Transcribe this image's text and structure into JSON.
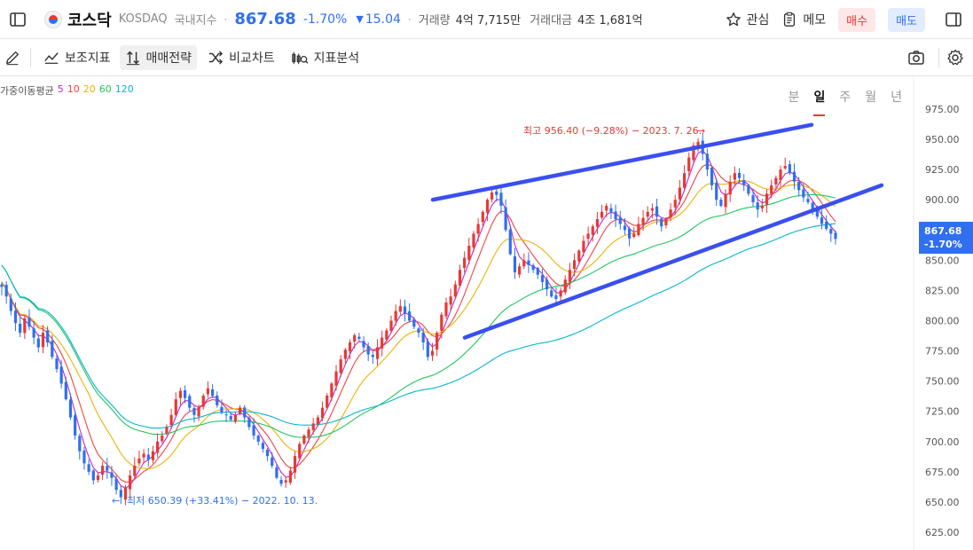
{
  "header": {
    "title": "코스닥",
    "code": "KOSDAQ",
    "category": "국내지수",
    "price": "867.68",
    "change_pct": "-1.70%",
    "change_abs": "15.04",
    "volume_label": "거래량",
    "volume_value": "4억 7,715만",
    "amount_label": "거래대금",
    "amount_value": "4조 1,681억",
    "watch_label": "관심",
    "memo_label": "메모",
    "buy_label": "매수",
    "sell_label": "매도",
    "colors": {
      "up": "#e53935",
      "down": "#2f6ff0"
    }
  },
  "toolbar": {
    "indicators_label": "보조지표",
    "strategy_label": "매매전략",
    "compare_label": "비교차트",
    "analysis_label": "지표분석",
    "periods": [
      "분",
      "일",
      "주",
      "월",
      "년"
    ],
    "active_period": "일"
  },
  "ma_legend": {
    "title": "가중이동평균",
    "items": [
      {
        "label": "5",
        "color": "#c026d3"
      },
      {
        "label": "10",
        "color": "#ef4444"
      },
      {
        "label": "20",
        "color": "#eab308"
      },
      {
        "label": "60",
        "color": "#22c55e"
      },
      {
        "label": "120",
        "color": "#06b6d4"
      }
    ]
  },
  "chart_data": {
    "type": "candlestick",
    "y_ticks": [
      "975.00",
      "950.00",
      "925.00",
      "900.00",
      "875.00",
      "850.00",
      "825.00",
      "800.00",
      "775.00",
      "750.00",
      "725.00",
      "700.00",
      "675.00",
      "650.00",
      "625.00"
    ],
    "ylim": [
      625,
      975
    ],
    "current_price_label": "867.68",
    "current_change_label": "-1.70%",
    "high_annotation": "최고 956.40 (−9.28%) − 2023. 7. 26.",
    "low_annotation": "최저 650.39 (+33.41%) − 2022. 10. 13.",
    "close_series": [
      828,
      820,
      808,
      798,
      790,
      802,
      795,
      786,
      778,
      790,
      782,
      770,
      760,
      748,
      735,
      720,
      705,
      692,
      682,
      675,
      668,
      672,
      680,
      676,
      670,
      660,
      654,
      662,
      672,
      680,
      686,
      690,
      685,
      692,
      700,
      705,
      712,
      722,
      735,
      742,
      736,
      728,
      722,
      728,
      738,
      744,
      738,
      730,
      724,
      722,
      718,
      722,
      728,
      720,
      712,
      705,
      700,
      694,
      688,
      680,
      670,
      665,
      668,
      676,
      688,
      698,
      705,
      710,
      715,
      720,
      728,
      738,
      748,
      758,
      768,
      776,
      782,
      788,
      785,
      778,
      772,
      770,
      778,
      786,
      792,
      800,
      808,
      812,
      806,
      800,
      795,
      790,
      782,
      770,
      775,
      790,
      805,
      815,
      820,
      830,
      842,
      852,
      862,
      872,
      880,
      890,
      900,
      906,
      904,
      895,
      875,
      855,
      840,
      845,
      850,
      846,
      842,
      838,
      832,
      826,
      820,
      818,
      825,
      834,
      842,
      850,
      858,
      866,
      872,
      878,
      884,
      890,
      895,
      890,
      884,
      880,
      875,
      868,
      872,
      880,
      885,
      890,
      893,
      886,
      878,
      884,
      892,
      900,
      910,
      922,
      935,
      945,
      948,
      938,
      925,
      912,
      900,
      895,
      905,
      915,
      922,
      918,
      912,
      905,
      898,
      892,
      895,
      905,
      912,
      918,
      925,
      928,
      922,
      915,
      908,
      902,
      898,
      892,
      886,
      880,
      876,
      872,
      867.68
    ],
    "trendlines": [
      {
        "name": "upper-channel",
        "points": [
          [
            "start",
            900
          ],
          [
            "end",
            962
          ]
        ]
      },
      {
        "name": "lower-channel",
        "points": [
          [
            "start",
            786
          ],
          [
            "end",
            912
          ]
        ]
      }
    ]
  }
}
